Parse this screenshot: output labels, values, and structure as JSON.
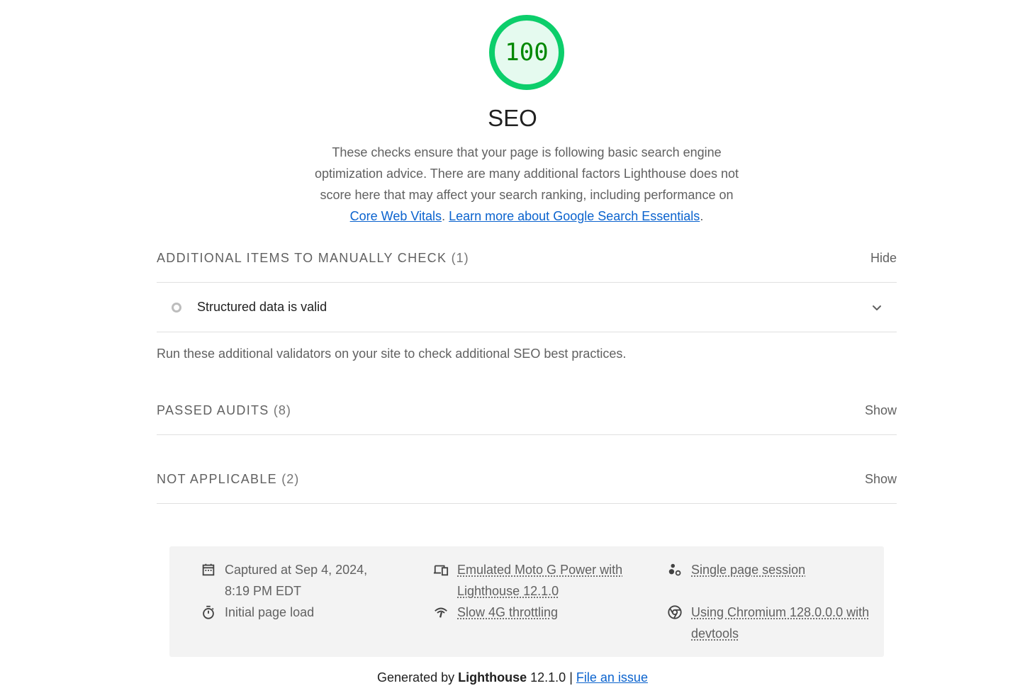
{
  "score": {
    "value": "100",
    "color": "#0cce6b",
    "text_color": "#008800",
    "fill_color": "#e5faef"
  },
  "category": {
    "title": "SEO",
    "description_text": "These checks ensure that your page is following basic search engine optimization advice. There are many additional factors Lighthouse does not score here that may affect your search ranking, including performance on",
    "link1": "Core Web Vitals",
    "separator": ".",
    "link2": "Learn more about Google Search Essentials",
    "end": "."
  },
  "groups": {
    "manual": {
      "title": "ADDITIONAL ITEMS TO MANUALLY CHECK",
      "count": "(1)",
      "toggle": "Hide",
      "audit": "Structured data is valid",
      "description": "Run these additional validators on your site to check additional SEO best practices."
    },
    "passed": {
      "title": "PASSED AUDITS",
      "count": "(8)",
      "toggle": "Show"
    },
    "not_applicable": {
      "title": "NOT APPLICABLE",
      "count": "(2)",
      "toggle": "Show"
    }
  },
  "environment": {
    "captured": "Captured at Sep 4, 2024, 8:19 PM EDT",
    "load": "Initial page load",
    "device": "Emulated Moto G Power with Lighthouse 12.1.0",
    "throttling": "Slow 4G throttling",
    "session": "Single page session",
    "browser": "Using Chromium 128.0.0.0 with devtools",
    "icons": [
      "calendar-icon",
      "timer-icon",
      "devices-icon",
      "network-icon",
      "session-icon",
      "chrome-icon"
    ]
  },
  "footer": {
    "generated_by": "Generated by",
    "product": "Lighthouse",
    "version": "12.1.0",
    "pipe": "|",
    "issue_link": "File an issue"
  }
}
